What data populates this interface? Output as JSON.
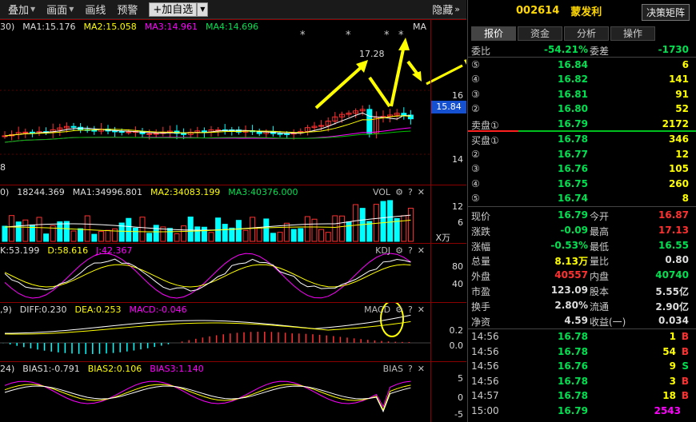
{
  "toolbar": {
    "overlay": "叠加",
    "draw": "画面",
    "lines": "画线",
    "alert": "预警",
    "add_watch": "+加自选",
    "hide": "隐藏"
  },
  "colors": {
    "up": "#ff3030",
    "down": "#00ffff",
    "ma1": "#ffffff",
    "ma2": "#ffff00",
    "ma3": "#ff00ff",
    "ma4": "#00c000",
    "arrow": "#ffff00"
  },
  "main": {
    "legend_pre": "30)",
    "ma1": "MA1:15.176",
    "ma2": "MA2:15.058",
    "ma3": "MA3:14.961",
    "ma4": "MA4:14.696",
    "tag": "MA",
    "high_label": "17.28",
    "axis_16": "16",
    "axis_14": "14",
    "price_box": "15.84",
    "bottom_label": "8",
    "stars": "*"
  },
  "vol": {
    "legend_pre": "0)",
    "vol": "18244.369",
    "ma1": "MA1:34996.801",
    "ma2": "MA2:34083.199",
    "ma3": "MA3:40376.000",
    "tag": "VOL",
    "axis_12": "12",
    "axis_6": "6",
    "unit": "X万"
  },
  "kdj": {
    "k": "K:53.199",
    "d": "D:58.616",
    "j": "J:42.367",
    "tag": "KDJ",
    "axis_80": "80",
    "axis_40": "40"
  },
  "macd": {
    "legend_pre": ",9)",
    "diff": "DIFF:0.230",
    "dea": "DEA:0.253",
    "macd": "MACD:-0.046",
    "tag": "MACD",
    "axis_02": "0.2",
    "axis_00": "0.0"
  },
  "bias": {
    "legend_pre": "24)",
    "b1": "BIAS1:-0.791",
    "b2": "BIAS2:0.106",
    "b3": "BIAS3:1.140",
    "tag": "BIAS",
    "axis_5": "5",
    "axis_0": "0",
    "axis_m5": "-5"
  },
  "ctrl": {
    "gear": "⚙",
    "help": "?",
    "close": "✕"
  },
  "quote": {
    "code": "002614",
    "name": "蒙发利",
    "matrix_btn": "决策矩阵",
    "tabs": [
      "报价",
      "资金",
      "分析",
      "操作"
    ],
    "ratio_label": "委比",
    "ratio": "-54.21%",
    "diff_label": "委差",
    "diff": "-1730",
    "asks": [
      {
        "lvl": "⑤",
        "price": "16.84",
        "vol": "6"
      },
      {
        "lvl": "④",
        "price": "16.82",
        "vol": "141"
      },
      {
        "lvl": "③",
        "price": "16.81",
        "vol": "91"
      },
      {
        "lvl": "②",
        "price": "16.80",
        "vol": "52"
      },
      {
        "lvl": "卖盘①",
        "price": "16.79",
        "vol": "2172"
      }
    ],
    "bids": [
      {
        "lvl": "买盘①",
        "price": "16.78",
        "vol": "346"
      },
      {
        "lvl": "②",
        "price": "16.77",
        "vol": "12"
      },
      {
        "lvl": "③",
        "price": "16.76",
        "vol": "105"
      },
      {
        "lvl": "④",
        "price": "16.75",
        "vol": "260"
      },
      {
        "lvl": "⑤",
        "price": "16.74",
        "vol": "8"
      }
    ],
    "stats": [
      {
        "l1": "现价",
        "v1": "16.79",
        "l2": "今开",
        "v2": "16.87"
      },
      {
        "l1": "涨跌",
        "v1": "-0.09",
        "l2": "最高",
        "v2": "17.13"
      },
      {
        "l1": "涨幅",
        "v1": "-0.53%",
        "l2": "最低",
        "v2": "16.55"
      },
      {
        "l1": "总量",
        "v1": "8.13万",
        "l2": "量比",
        "v2": "0.80"
      },
      {
        "l1": "外盘",
        "v1": "40557",
        "l2": "内盘",
        "v2": "40740"
      },
      {
        "l1": "市盈",
        "v1": "123.09",
        "l2": "股本",
        "v2": "5.55亿"
      },
      {
        "l1": "换手",
        "v1": "2.80%",
        "l2": "流通",
        "v2": "2.90亿"
      },
      {
        "l1": "净资",
        "v1": "4.59",
        "l2": "收益(一)",
        "v2": "0.034"
      }
    ],
    "trades": [
      {
        "t": "14:56",
        "p": "16.78",
        "v": "1",
        "s": "B"
      },
      {
        "t": "14:56",
        "p": "16.78",
        "v": "54",
        "s": "B"
      },
      {
        "t": "14:56",
        "p": "16.76",
        "v": "9",
        "s": "S"
      },
      {
        "t": "14:56",
        "p": "16.78",
        "v": "3",
        "s": "B"
      },
      {
        "t": "14:57",
        "p": "16.78",
        "v": "18",
        "s": "B"
      },
      {
        "t": "15:00",
        "p": "16.79",
        "v": "2543",
        "s": ""
      }
    ]
  }
}
